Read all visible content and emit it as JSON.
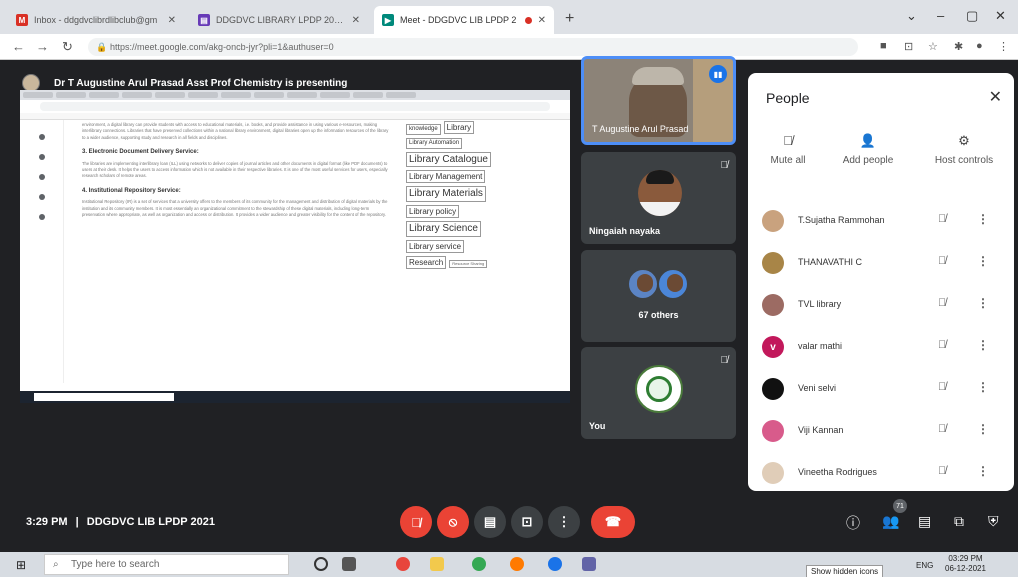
{
  "browser": {
    "tabs": [
      {
        "title": "Inbox - ddgdvclibrdlibclub@gm",
        "favicon_color": "#d93025",
        "favicon_glyph": "M"
      },
      {
        "title": "DDGDVC LIBRARY LPDP 2021 FI",
        "favicon_color": "#673ab7",
        "favicon_glyph": "▤"
      },
      {
        "title": "Meet - DDGDVC LIB LPDP 2",
        "favicon_color": "#00897b",
        "favicon_glyph": "▶"
      }
    ],
    "url": "https://meet.google.com/akg-oncb-jyr?pli=1&authuser=0",
    "nav_icons": [
      "back-arrow-icon",
      "forward-arrow-icon",
      "reload-icon"
    ]
  },
  "presenter": {
    "label": "Dr T Augustine Arul Prasad Asst Prof Chemistry is presenting"
  },
  "shared_doc": {
    "heading_2": "3. Electronic Document Delivery Service:",
    "heading_3": "4. Institutional Repository Service:",
    "tags": [
      {
        "text": "knowledge",
        "size": "s"
      },
      {
        "text": "Library",
        "size": "m"
      },
      {
        "text": "Library Automation",
        "size": "s"
      },
      {
        "text": "Library Catalogue",
        "size": "l"
      },
      {
        "text": "Library Management",
        "size": "m"
      },
      {
        "text": "Library Materials",
        "size": "l"
      },
      {
        "text": "Library policy",
        "size": "m"
      },
      {
        "text": "Library Science",
        "size": "l"
      },
      {
        "text": "Library service",
        "size": "m"
      },
      {
        "text": "Research",
        "size": "m"
      },
      {
        "text": "Resource Sharing",
        "size": "xs"
      }
    ]
  },
  "tiles": {
    "speaker_name": "T Augustine Arul Prasad",
    "ningaiah_name": "Ningaiah nayaka",
    "others_count": "67 others",
    "you_label": "You"
  },
  "people_panel": {
    "title": "People",
    "actions": [
      {
        "label": "Mute all",
        "icon": "mute-all-icon",
        "glyph": "🎙"
      },
      {
        "label": "Add people",
        "icon": "add-person-icon",
        "glyph": "👤+"
      },
      {
        "label": "Host controls",
        "icon": "host-controls-icon",
        "glyph": "⚙"
      }
    ],
    "participants": [
      {
        "name": "T.Sujatha Rammohan",
        "avatar_color": "#c9a27e"
      },
      {
        "name": "THANAVATHI C",
        "avatar_color": "#a88547"
      },
      {
        "name": "TVL library",
        "avatar_color": "#9c6b63"
      },
      {
        "name": "valar mathi",
        "avatar_color": "#c2185b"
      },
      {
        "name": "Veni selvi",
        "avatar_color": "#111111"
      },
      {
        "name": "Viji Kannan",
        "avatar_color": "#d85b8b"
      },
      {
        "name": "Vineetha Rodrigues",
        "avatar_color": "#e0cdb8"
      }
    ]
  },
  "controls": {
    "clock": "3:29 PM",
    "separator": "|",
    "meeting_name": "DDGDVC LIB LPDP 2021",
    "people_count": "71",
    "colors": {
      "danger": "#ea4335",
      "dark": "#3c4043",
      "accent": "#1a73e8"
    }
  },
  "taskbar": {
    "search_placeholder": "Type here to search",
    "tooltip": "Show hidden icons",
    "lang": "ENG",
    "time": "03:29 PM",
    "date": "06-12-2021"
  }
}
